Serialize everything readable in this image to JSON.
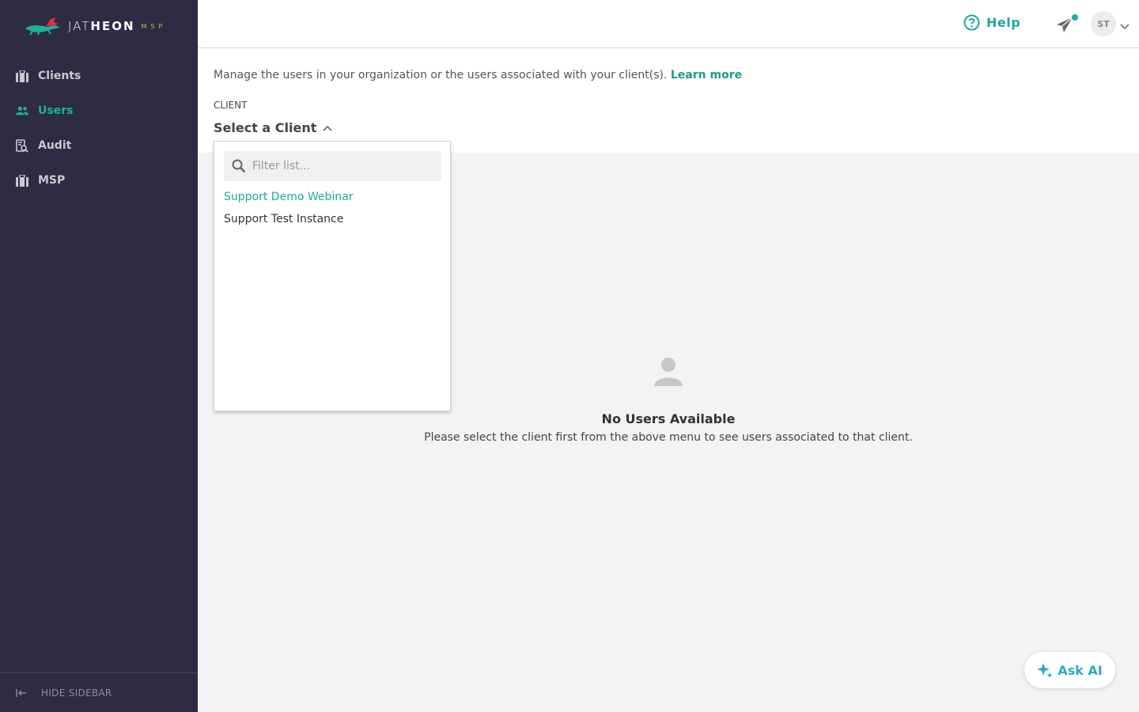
{
  "brand": {
    "name_light": "JAT",
    "name_bold": "HEON",
    "suffix": "MSP"
  },
  "sidebar": {
    "items": [
      {
        "label": "Clients",
        "icon": "briefcase-icon",
        "active": false
      },
      {
        "label": "Users",
        "icon": "users-icon",
        "active": true
      },
      {
        "label": "Audit",
        "icon": "audit-icon",
        "active": false
      },
      {
        "label": "MSP",
        "icon": "briefcase-icon",
        "active": false
      }
    ],
    "footer_label": "HIDE SIDEBAR"
  },
  "header": {
    "help_label": "Help",
    "avatar_initials": "ST"
  },
  "main": {
    "intro_text": "Manage the users in your organization or the users associated with your client(s). ",
    "learn_more": "Learn more",
    "client_label": "CLIENT",
    "client_select_label": "Select a Client"
  },
  "dropdown": {
    "filter_placeholder": "Filter list...",
    "options": [
      {
        "label": "Support Demo Webinar",
        "selected": true
      },
      {
        "label": "Support Test Instance",
        "selected": false
      }
    ]
  },
  "empty_state": {
    "title": "No Users Available",
    "description": "Please select the client first from the above menu to see users associated to that client."
  },
  "ask_ai_label": "Ask AI",
  "colors": {
    "sidebar": "#2e2b45",
    "accent": "#1fb29a",
    "ask_ai": "#2ba9c9"
  }
}
